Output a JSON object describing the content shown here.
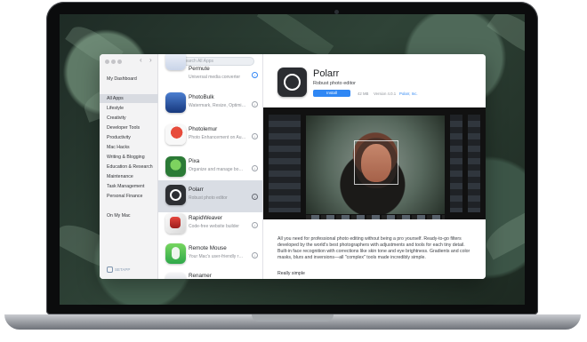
{
  "window": {
    "title": "Setapp"
  },
  "sidebar": {
    "items": [
      {
        "label": "My Dashboard",
        "selected": false
      },
      {
        "label": "All Apps",
        "selected": true
      },
      {
        "label": "Lifestyle",
        "selected": false
      },
      {
        "label": "Creativity",
        "selected": false
      },
      {
        "label": "Developer Tools",
        "selected": false
      },
      {
        "label": "Productivity",
        "selected": false
      },
      {
        "label": "Mac Hacks",
        "selected": false
      },
      {
        "label": "Writing & Blogging",
        "selected": false
      },
      {
        "label": "Education & Research",
        "selected": false
      },
      {
        "label": "Maintenance",
        "selected": false
      },
      {
        "label": "Task Management",
        "selected": false
      },
      {
        "label": "Personal Finance",
        "selected": false
      },
      {
        "label": "On My Mac",
        "selected": false
      }
    ],
    "brand": "SETAPP"
  },
  "search": {
    "placeholder": "Search All Apps",
    "icon": "search-icon"
  },
  "apps": [
    {
      "name": "Permute",
      "description": "Universal media converter",
      "icon": "permute-app-icon",
      "selected": false
    },
    {
      "name": "PhotoBulk",
      "description": "Watermark, Resize, Optimi…",
      "icon": "photobulk-app-icon",
      "selected": false
    },
    {
      "name": "Photolemur",
      "description": "Photo Enhancement on Au…",
      "icon": "photolemur-app-icon",
      "selected": false
    },
    {
      "name": "Pixa",
      "description": "Organize and manage bo…",
      "icon": "pixa-app-icon",
      "selected": false
    },
    {
      "name": "Polarr",
      "description": "Robust photo editor",
      "icon": "polarr-app-icon",
      "selected": true
    },
    {
      "name": "RapidWeaver",
      "description": "Code-free website builder",
      "icon": "rapidweaver-app-icon",
      "selected": false
    },
    {
      "name": "Remote Mouse",
      "description": "Your Mac's user-friendly r…",
      "icon": "remote-mouse-app-icon",
      "selected": false
    },
    {
      "name": "Renamer",
      "description": "",
      "icon": "renamer-app-icon",
      "selected": false
    }
  ],
  "detail": {
    "title": "Polarr",
    "subtitle": "Robust photo editor",
    "install_label": "Install",
    "size": "42 MB",
    "version": "Version 4.0.1",
    "developer": "Polarr, Inc.",
    "description": "All you need for professional photo editing without being a pro yourself. Ready-to-go filters developed by the world's best photographers with adjustments and tools for each tiny detail. Built-in face recognition with corrections like skin tone and eye brightness. Gradients and color masks, blurs and inversions—all \"complex\" tools made incredibly simple.",
    "section_heading": "Really simple"
  },
  "colors": {
    "accent": "#2f87f4",
    "selected_row": "#d9dde4",
    "sidebar_bg": "#f3f3f4"
  }
}
